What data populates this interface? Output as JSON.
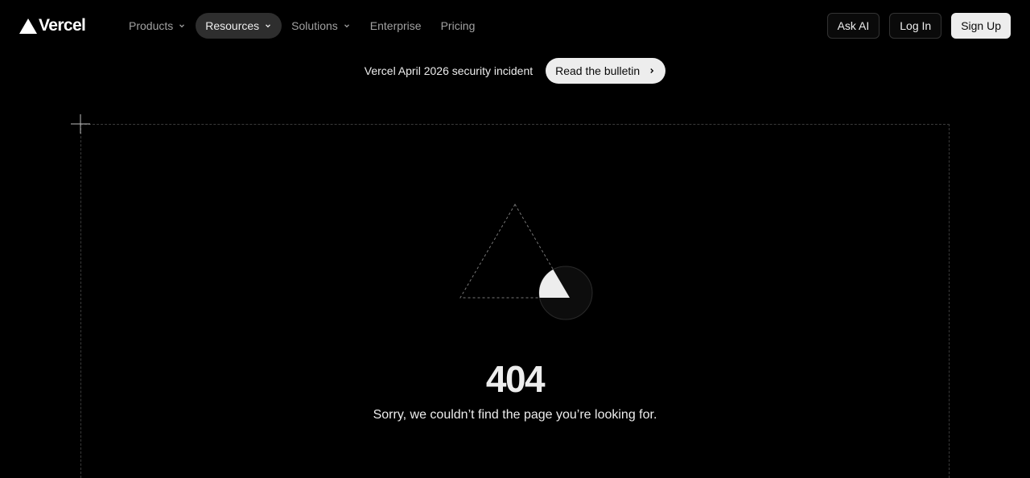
{
  "header": {
    "logo_text": "Vercel",
    "nav": [
      {
        "label": "Products",
        "has_chevron": true
      },
      {
        "label": "Resources",
        "has_chevron": true,
        "active": true
      },
      {
        "label": "Solutions",
        "has_chevron": true
      },
      {
        "label": "Enterprise",
        "has_chevron": false
      },
      {
        "label": "Pricing",
        "has_chevron": false
      }
    ],
    "actions": {
      "ask_ai": "Ask AI",
      "log_in": "Log In",
      "sign_up": "Sign Up"
    }
  },
  "banner": {
    "text": "Vercel April 2026 security incident",
    "link_label": "Read the bulletin"
  },
  "error": {
    "code": "404",
    "message": "Sorry, we couldn’t find the page you’re looking for."
  },
  "icons": {
    "logo": "vercel-triangle-icon",
    "chevron": "chevron-down-icon",
    "arrow": "chevron-right-icon"
  },
  "colors": {
    "background": "#000000",
    "text": "#ededed",
    "muted": "#a1a1a1",
    "active_nav_bg": "#2e2e2e",
    "button_light": "#ededed"
  }
}
